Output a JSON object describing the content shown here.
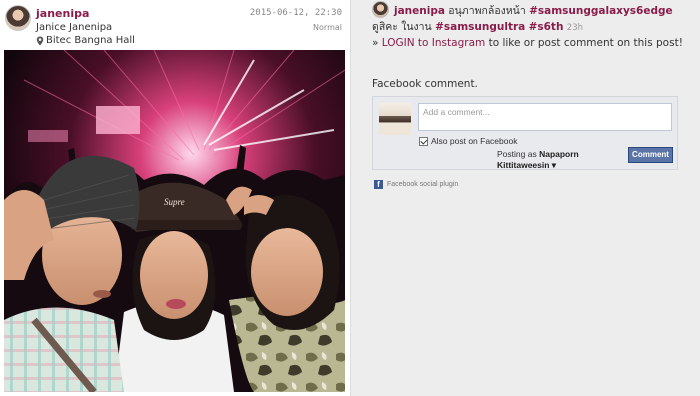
{
  "post": {
    "username": "janenipa",
    "full_name": "Janice Janenipa",
    "location": "Bitec Bangna Hall",
    "timestamp": "2015-06-12, 22:30",
    "filter": "Normal"
  },
  "caption": {
    "username": "janenipa",
    "text_pre": " อนุภาพกล้องหน้า ",
    "tag1": "#samsunggalaxys6edge",
    "text_mid": " ดูสิคะ ในงาน ",
    "tag2": "#samsungultra",
    "tag3": "#s6th",
    "age": "23h"
  },
  "login": {
    "prefix": "» ",
    "link": "LOGIN to Instagram",
    "suffix": " to like or post comment on this post!"
  },
  "facebook": {
    "heading": "Facebook comment.",
    "placeholder": "Add a comment...",
    "also_post_label": "Also post on Facebook",
    "posting_as_label": "Posting as",
    "posting_as_name": "Napaporn",
    "posting_as_name2": "Kittitaweesin ▾",
    "comment_button": "Comment",
    "plugin_label": "Facebook social plugin"
  },
  "icons": {
    "location": "pin-icon",
    "facebook": "facebook-icon"
  },
  "colors": {
    "accent": "#8a1c4a",
    "fb_button": "#5b74a8"
  }
}
